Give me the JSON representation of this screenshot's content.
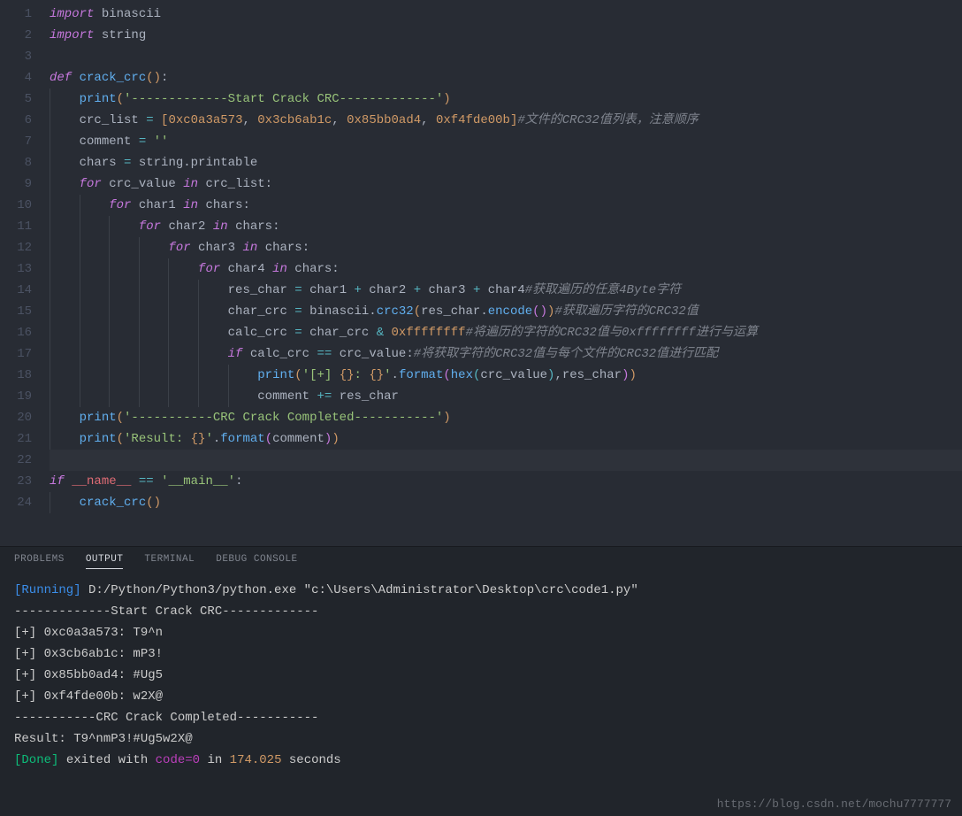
{
  "lines": [
    {
      "n": 1,
      "tokens": [
        {
          "c": "kw",
          "t": "import "
        },
        {
          "c": "var2",
          "t": "binascii"
        }
      ]
    },
    {
      "n": 2,
      "tokens": [
        {
          "c": "kw",
          "t": "import "
        },
        {
          "c": "var2",
          "t": "string"
        }
      ]
    },
    {
      "n": 3,
      "tokens": []
    },
    {
      "n": 4,
      "tokens": [
        {
          "c": "kw",
          "t": "def "
        },
        {
          "c": "def",
          "t": "crack_crc"
        },
        {
          "c": "paren-y",
          "t": "()"
        },
        {
          "c": "var2",
          "t": ":"
        }
      ]
    },
    {
      "n": 5,
      "indent": 1,
      "tokens": [
        {
          "c": "fn",
          "t": "print"
        },
        {
          "c": "paren-y",
          "t": "("
        },
        {
          "c": "str",
          "t": "'-------------Start Crack CRC-------------'"
        },
        {
          "c": "paren-y",
          "t": ")"
        }
      ]
    },
    {
      "n": 6,
      "indent": 1,
      "tokens": [
        {
          "c": "var2",
          "t": "crc_list "
        },
        {
          "c": "op",
          "t": "="
        },
        {
          "c": "var2",
          "t": " "
        },
        {
          "c": "paren-y",
          "t": "["
        },
        {
          "c": "num",
          "t": "0xc0a3a573"
        },
        {
          "c": "var2",
          "t": ", "
        },
        {
          "c": "num",
          "t": "0x3cb6ab1c"
        },
        {
          "c": "var2",
          "t": ", "
        },
        {
          "c": "num",
          "t": "0x85bb0ad4"
        },
        {
          "c": "var2",
          "t": ", "
        },
        {
          "c": "num",
          "t": "0xf4fde00b"
        },
        {
          "c": "paren-y",
          "t": "]"
        },
        {
          "c": "cmt",
          "t": "#文件的CRC32值列表，注意顺序"
        }
      ]
    },
    {
      "n": 7,
      "indent": 1,
      "tokens": [
        {
          "c": "var2",
          "t": "comment "
        },
        {
          "c": "op",
          "t": "="
        },
        {
          "c": "var2",
          "t": " "
        },
        {
          "c": "str",
          "t": "''"
        }
      ]
    },
    {
      "n": 8,
      "indent": 1,
      "tokens": [
        {
          "c": "var2",
          "t": "chars "
        },
        {
          "c": "op",
          "t": "="
        },
        {
          "c": "var2",
          "t": " string.printable"
        }
      ]
    },
    {
      "n": 9,
      "indent": 1,
      "tokens": [
        {
          "c": "kw",
          "t": "for "
        },
        {
          "c": "var2",
          "t": "crc_value "
        },
        {
          "c": "kw",
          "t": "in "
        },
        {
          "c": "var2",
          "t": "crc_list:"
        }
      ]
    },
    {
      "n": 10,
      "indent": 2,
      "tokens": [
        {
          "c": "kw",
          "t": "for "
        },
        {
          "c": "var2",
          "t": "char1 "
        },
        {
          "c": "kw",
          "t": "in "
        },
        {
          "c": "var2",
          "t": "chars:"
        }
      ]
    },
    {
      "n": 11,
      "indent": 3,
      "tokens": [
        {
          "c": "kw",
          "t": "for "
        },
        {
          "c": "var2",
          "t": "char2 "
        },
        {
          "c": "kw",
          "t": "in "
        },
        {
          "c": "var2",
          "t": "chars:"
        }
      ]
    },
    {
      "n": 12,
      "indent": 4,
      "tokens": [
        {
          "c": "kw",
          "t": "for "
        },
        {
          "c": "var2",
          "t": "char3 "
        },
        {
          "c": "kw",
          "t": "in "
        },
        {
          "c": "var2",
          "t": "chars:"
        }
      ]
    },
    {
      "n": 13,
      "indent": 5,
      "tokens": [
        {
          "c": "kw",
          "t": "for "
        },
        {
          "c": "var2",
          "t": "char4 "
        },
        {
          "c": "kw",
          "t": "in "
        },
        {
          "c": "var2",
          "t": "chars:"
        }
      ]
    },
    {
      "n": 14,
      "indent": 6,
      "tokens": [
        {
          "c": "var2",
          "t": "res_char "
        },
        {
          "c": "op",
          "t": "="
        },
        {
          "c": "var2",
          "t": " char1 "
        },
        {
          "c": "op",
          "t": "+"
        },
        {
          "c": "var2",
          "t": " char2 "
        },
        {
          "c": "op",
          "t": "+"
        },
        {
          "c": "var2",
          "t": " char3 "
        },
        {
          "c": "op",
          "t": "+"
        },
        {
          "c": "var2",
          "t": " char4"
        },
        {
          "c": "cmt",
          "t": "#获取遍历的任意4Byte字符"
        }
      ]
    },
    {
      "n": 15,
      "indent": 6,
      "tokens": [
        {
          "c": "var2",
          "t": "char_crc "
        },
        {
          "c": "op",
          "t": "="
        },
        {
          "c": "var2",
          "t": " binascii."
        },
        {
          "c": "fn",
          "t": "crc32"
        },
        {
          "c": "paren-y",
          "t": "("
        },
        {
          "c": "var2",
          "t": "res_char."
        },
        {
          "c": "fn",
          "t": "encode"
        },
        {
          "c": "paren-p",
          "t": "()"
        },
        {
          "c": "paren-y",
          "t": ")"
        },
        {
          "c": "cmt",
          "t": "#获取遍历字符的CRC32值"
        }
      ]
    },
    {
      "n": 16,
      "indent": 6,
      "tokens": [
        {
          "c": "var2",
          "t": "calc_crc "
        },
        {
          "c": "op",
          "t": "="
        },
        {
          "c": "var2",
          "t": " char_crc "
        },
        {
          "c": "op",
          "t": "&"
        },
        {
          "c": "var2",
          "t": " "
        },
        {
          "c": "num",
          "t": "0xffffffff"
        },
        {
          "c": "cmt",
          "t": "#将遍历的字符的CRC32值与0xffffffff进行与运算"
        }
      ]
    },
    {
      "n": 17,
      "indent": 6,
      "tokens": [
        {
          "c": "kw",
          "t": "if "
        },
        {
          "c": "var2",
          "t": "calc_crc "
        },
        {
          "c": "op",
          "t": "=="
        },
        {
          "c": "var2",
          "t": " crc_value:"
        },
        {
          "c": "cmt",
          "t": "#将获取字符的CRC32值与每个文件的CRC32值进行匹配"
        }
      ]
    },
    {
      "n": 18,
      "indent": 7,
      "tokens": [
        {
          "c": "fn",
          "t": "print"
        },
        {
          "c": "paren-y",
          "t": "("
        },
        {
          "c": "str",
          "t": "'[+] "
        },
        {
          "c": "num",
          "t": "{}"
        },
        {
          "c": "str",
          "t": ": "
        },
        {
          "c": "num",
          "t": "{}"
        },
        {
          "c": "str",
          "t": "'"
        },
        {
          "c": "var2",
          "t": "."
        },
        {
          "c": "fn",
          "t": "format"
        },
        {
          "c": "paren-p",
          "t": "("
        },
        {
          "c": "fn",
          "t": "hex"
        },
        {
          "c": "paren-b",
          "t": "("
        },
        {
          "c": "var2",
          "t": "crc_value"
        },
        {
          "c": "paren-b",
          "t": ")"
        },
        {
          "c": "var2",
          "t": ",res_char"
        },
        {
          "c": "paren-p",
          "t": ")"
        },
        {
          "c": "paren-y",
          "t": ")"
        }
      ]
    },
    {
      "n": 19,
      "indent": 7,
      "tokens": [
        {
          "c": "var2",
          "t": "comment "
        },
        {
          "c": "op",
          "t": "+="
        },
        {
          "c": "var2",
          "t": " res_char"
        }
      ]
    },
    {
      "n": 20,
      "indent": 1,
      "tokens": [
        {
          "c": "fn",
          "t": "print"
        },
        {
          "c": "paren-y",
          "t": "("
        },
        {
          "c": "str",
          "t": "'-----------CRC Crack Completed-----------'"
        },
        {
          "c": "paren-y",
          "t": ")"
        }
      ]
    },
    {
      "n": 21,
      "indent": 1,
      "tokens": [
        {
          "c": "fn",
          "t": "print"
        },
        {
          "c": "paren-y",
          "t": "("
        },
        {
          "c": "str",
          "t": "'Result: "
        },
        {
          "c": "num",
          "t": "{}"
        },
        {
          "c": "str",
          "t": "'"
        },
        {
          "c": "var2",
          "t": "."
        },
        {
          "c": "fn",
          "t": "format"
        },
        {
          "c": "paren-p",
          "t": "("
        },
        {
          "c": "var2",
          "t": "comment"
        },
        {
          "c": "paren-p",
          "t": ")"
        },
        {
          "c": "paren-y",
          "t": ")"
        }
      ]
    },
    {
      "n": 22,
      "tokens": [],
      "hl": true
    },
    {
      "n": 23,
      "tokens": [
        {
          "c": "kw",
          "t": "if "
        },
        {
          "c": "var",
          "t": "__name__"
        },
        {
          "c": "var2",
          "t": " "
        },
        {
          "c": "op",
          "t": "=="
        },
        {
          "c": "var2",
          "t": " "
        },
        {
          "c": "str",
          "t": "'__main__'"
        },
        {
          "c": "var2",
          "t": ":"
        }
      ]
    },
    {
      "n": 24,
      "indent": 1,
      "tokens": [
        {
          "c": "fn",
          "t": "crack_crc"
        },
        {
          "c": "paren-y",
          "t": "()"
        }
      ]
    }
  ],
  "tabs": {
    "problems": "PROBLEMS",
    "output": "OUTPUT",
    "terminal": "TERMINAL",
    "debug": "DEBUG CONSOLE"
  },
  "terminal": {
    "running": "[Running]",
    "command": " D:/Python/Python3/python.exe \"c:\\Users\\Administrator\\Desktop\\crc\\code1.py\"",
    "lines": [
      "-------------Start Crack CRC-------------",
      "[+] 0xc0a3a573: T9^n",
      "[+] 0x3cb6ab1c: mP3!",
      "[+] 0x85bb0ad4: #Ug5",
      "[+] 0xf4fde00b: w2X@",
      "-----------CRC Crack Completed-----------",
      "Result: T9^nmP3!#Ug5w2X@",
      ""
    ],
    "done": "[Done]",
    "exited": " exited with ",
    "codeLabel": "code=",
    "codeVal": "0",
    "in": " in ",
    "time": "174.025",
    "seconds": " seconds"
  },
  "watermark": "https://blog.csdn.net/mochu7777777"
}
